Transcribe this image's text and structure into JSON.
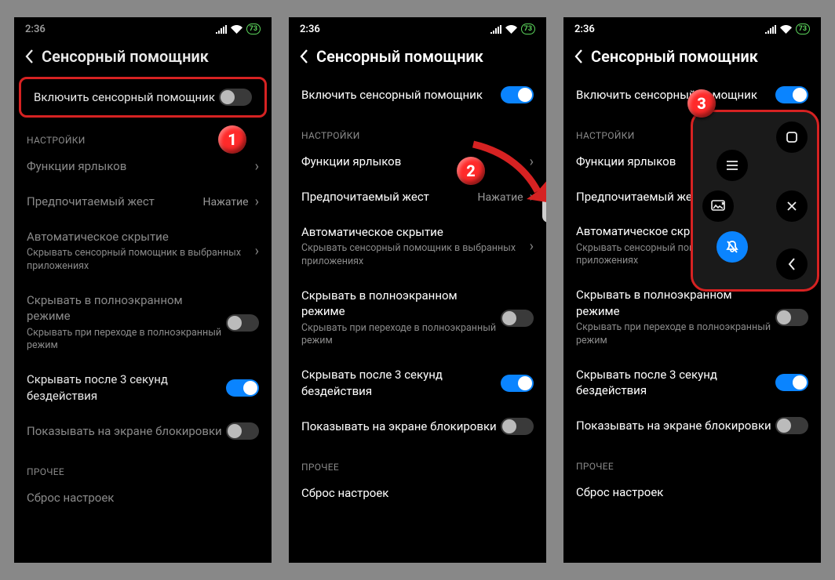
{
  "statusbar": {
    "time": "2:36",
    "battery": "73"
  },
  "header": {
    "title": "Сенсорный помощник"
  },
  "main_toggle": {
    "label": "Включить сенсорный помощник"
  },
  "sections": {
    "settings": "НАСТРОЙКИ",
    "other": "ПРОЧЕЕ"
  },
  "items": {
    "shortcuts": {
      "label": "Функции ярлыков"
    },
    "gesture": {
      "label": "Предпочитаемый жест",
      "value": "Нажатие"
    },
    "autohide": {
      "label": "Автоматическое скрытие",
      "sub": "Скрывать сенсорный помощник в выбранных приложениях"
    },
    "fullscreen": {
      "label": "Скрывать в полноэкранном режиме",
      "sub": "Скрывать при переходе в полноэкранный режим"
    },
    "hide3s": {
      "label": "Скрывать после 3 секунд бездействия"
    },
    "lockscreen": {
      "label": "Показывать на экране блокировки"
    },
    "reset": {
      "label": "Сброс настроек"
    }
  },
  "badges": {
    "b1": "1",
    "b2": "2",
    "b3": "3"
  },
  "quickball_icons": {
    "home": "home-icon",
    "menu": "menu-icon",
    "screenshot": "screenshot-icon",
    "close": "close-icon",
    "mute": "mute-icon",
    "back": "back-icon"
  }
}
